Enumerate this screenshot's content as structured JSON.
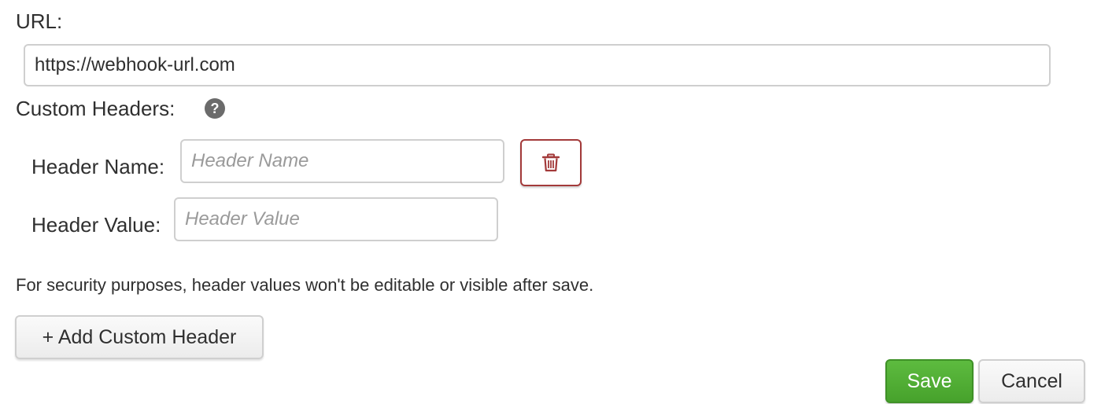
{
  "form": {
    "url_label": "URL:",
    "url_value": "https://webhook-url.com",
    "custom_headers_label": "Custom Headers:",
    "help_icon": "question-circle-icon",
    "header": {
      "name_label": "Header Name:",
      "name_placeholder": "Header Name",
      "value_label": "Header Value:",
      "value_placeholder": "Header Value",
      "delete_icon": "trash-icon"
    },
    "security_note": "For security purposes, header values won't be editable or visible after save.",
    "add_header_label": "+ Add Custom Header"
  },
  "actions": {
    "save_label": "Save",
    "cancel_label": "Cancel"
  },
  "colors": {
    "primary": "#4caf34",
    "danger": "#a33a3a",
    "border": "#cfcfcf",
    "text": "#2f2f2f",
    "placeholder": "#9a9a9a"
  }
}
